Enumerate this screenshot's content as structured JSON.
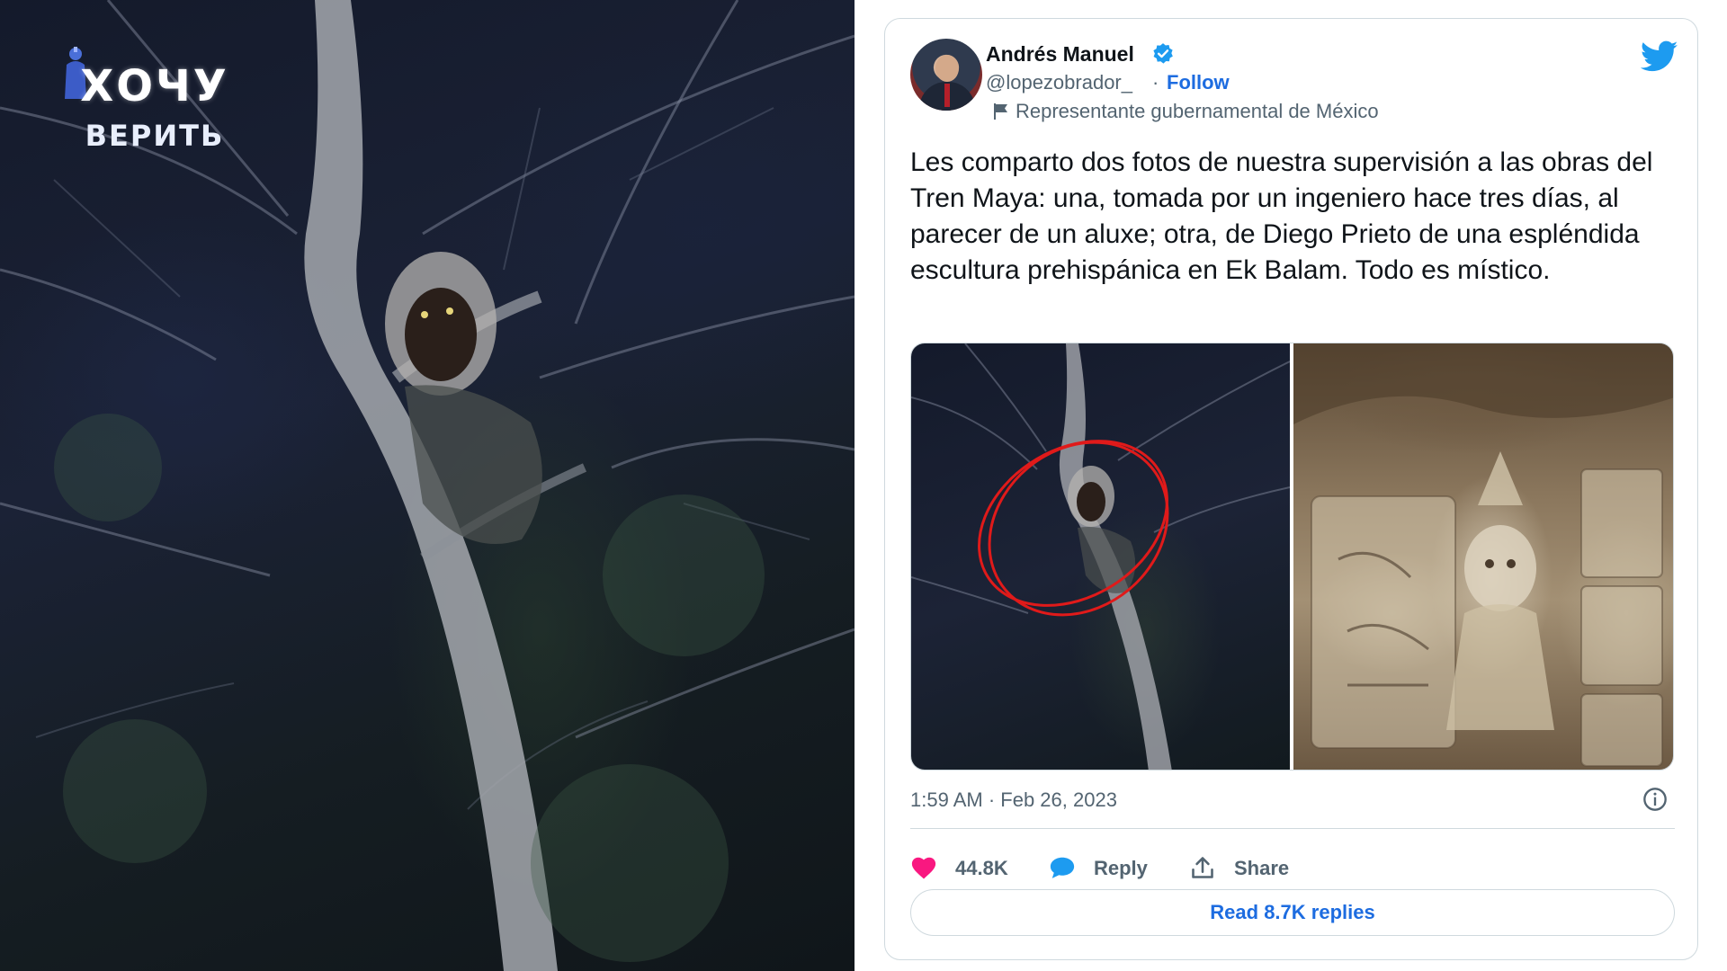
{
  "overlay_logo": {
    "line1": "ХОЧУ",
    "line2": "ВЕРИТЬ"
  },
  "tweet": {
    "author_name": "Andrés Manuel",
    "handle": "@lopezobrador_",
    "separator": "·",
    "follow_label": "Follow",
    "account_label": "Representante gubernamental de México",
    "text": "Les comparto dos fotos de nuestra supervisión a las obras del Tren Maya: una, tomada por un ingeniero hace tres días, al parecer de un aluxe; otra, de Diego Prieto de una espléndida escultura prehispánica en Ek Balam. Todo es místico.",
    "timestamp": "1:59 AM · Feb 26, 2023",
    "likes": "44.8K",
    "reply_label": "Reply",
    "share_label": "Share",
    "read_replies_label": "Read 8.7K replies"
  },
  "icons": {
    "verified": "verified-badge-icon",
    "platform": "twitter-bird-icon",
    "account_type": "flag-icon",
    "info": "info-icon",
    "like": "heart-icon",
    "reply": "speech-bubble-icon",
    "share": "share-upload-icon"
  },
  "colors": {
    "link_blue": "#1d6ce0",
    "heart_pink": "#f91880",
    "verified_blue": "#1d9bf0",
    "circle_red": "#e01a1a"
  }
}
